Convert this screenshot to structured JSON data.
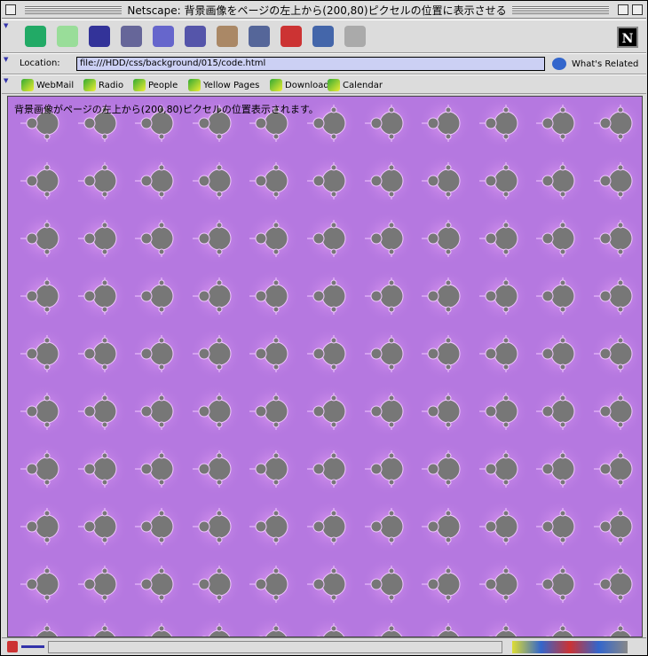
{
  "window": {
    "title": "Netscape: 背景画像をページの左上から(200,80)ピクセルの位置に表示させる"
  },
  "toolbar": {
    "icons": [
      "back-icon",
      "forward-icon",
      "reload-icon",
      "home-icon",
      "search-icon",
      "my-netscape-icon",
      "images-icon",
      "print-icon",
      "security-icon",
      "shop-icon",
      "stop-icon"
    ]
  },
  "location": {
    "label": "Location:",
    "url": "file:///HDD/css/background/015/code.html",
    "related": "What's Related"
  },
  "personal_toolbar": [
    "WebMail",
    "Radio",
    "People",
    "Yellow Pages",
    "Download",
    "Calendar"
  ],
  "page": {
    "text": "背景画像がページの左上から(200,80)ピクセルの位置表示されます。"
  },
  "colors": {
    "background": "#b578e0",
    "glow": "#e4a0f4",
    "fractal": "#777777"
  }
}
